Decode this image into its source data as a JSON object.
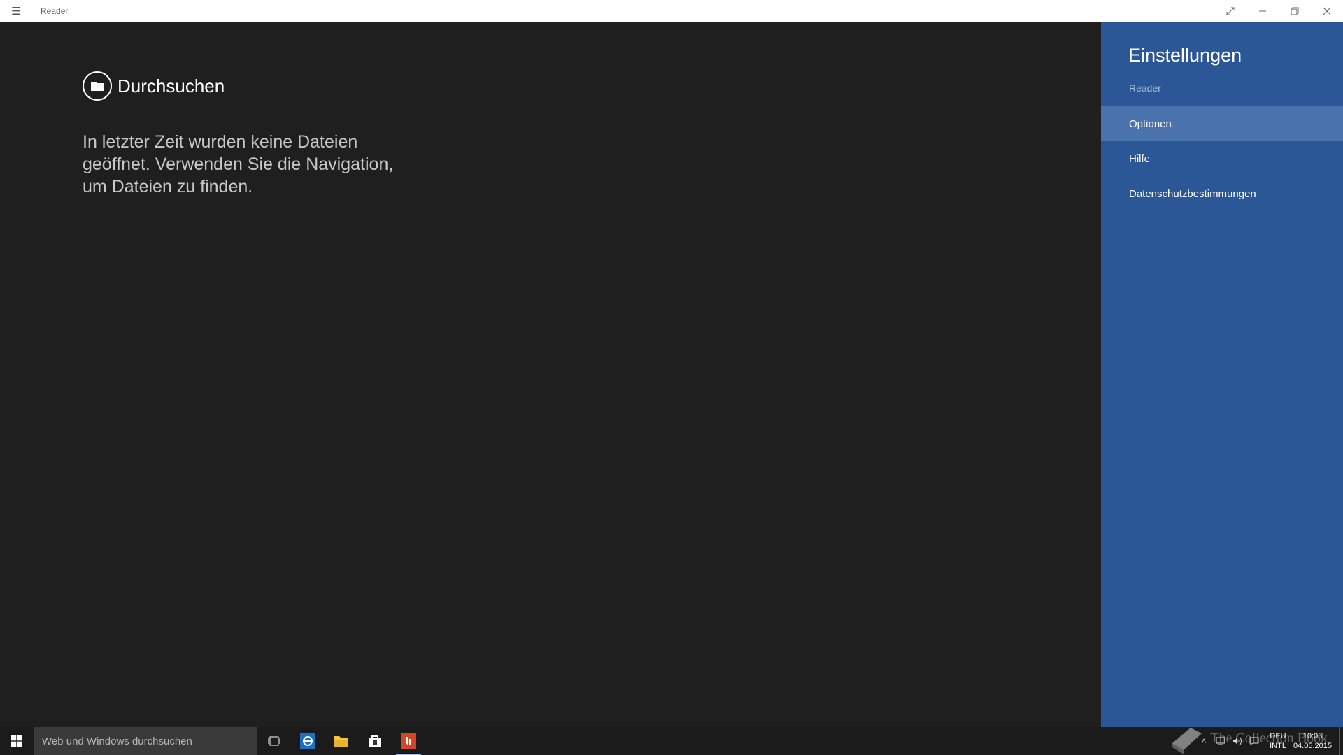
{
  "titlebar": {
    "app_title": "Reader",
    "icons": [
      "hamburger-icon",
      "fullscreen-icon",
      "minimize-icon",
      "restore-icon",
      "close-icon"
    ]
  },
  "main": {
    "browse_label": "Durchsuchen",
    "empty_message": "In letzter Zeit wurden keine Dateien geöffnet. Verwenden Sie die Navigation, um Dateien zu finden."
  },
  "settings": {
    "title": "Einstellungen",
    "subtitle": "Reader",
    "items": [
      {
        "label": "Optionen",
        "active": true
      },
      {
        "label": "Hilfe",
        "active": false
      },
      {
        "label": "Datenschutzbestimmungen",
        "active": false
      }
    ],
    "background_color": "#2b5797",
    "active_color": "#4a73ad"
  },
  "taskbar": {
    "search_placeholder": "Web und Windows durchsuchen",
    "apps": [
      "task-view-icon",
      "ie-icon",
      "file-explorer-icon",
      "store-icon",
      "reader-icon"
    ],
    "language_top": "DEU",
    "language_bottom": "INTL",
    "time": "10:03",
    "date": "04.05.2015"
  },
  "watermark": {
    "text": "The Collection Book"
  }
}
